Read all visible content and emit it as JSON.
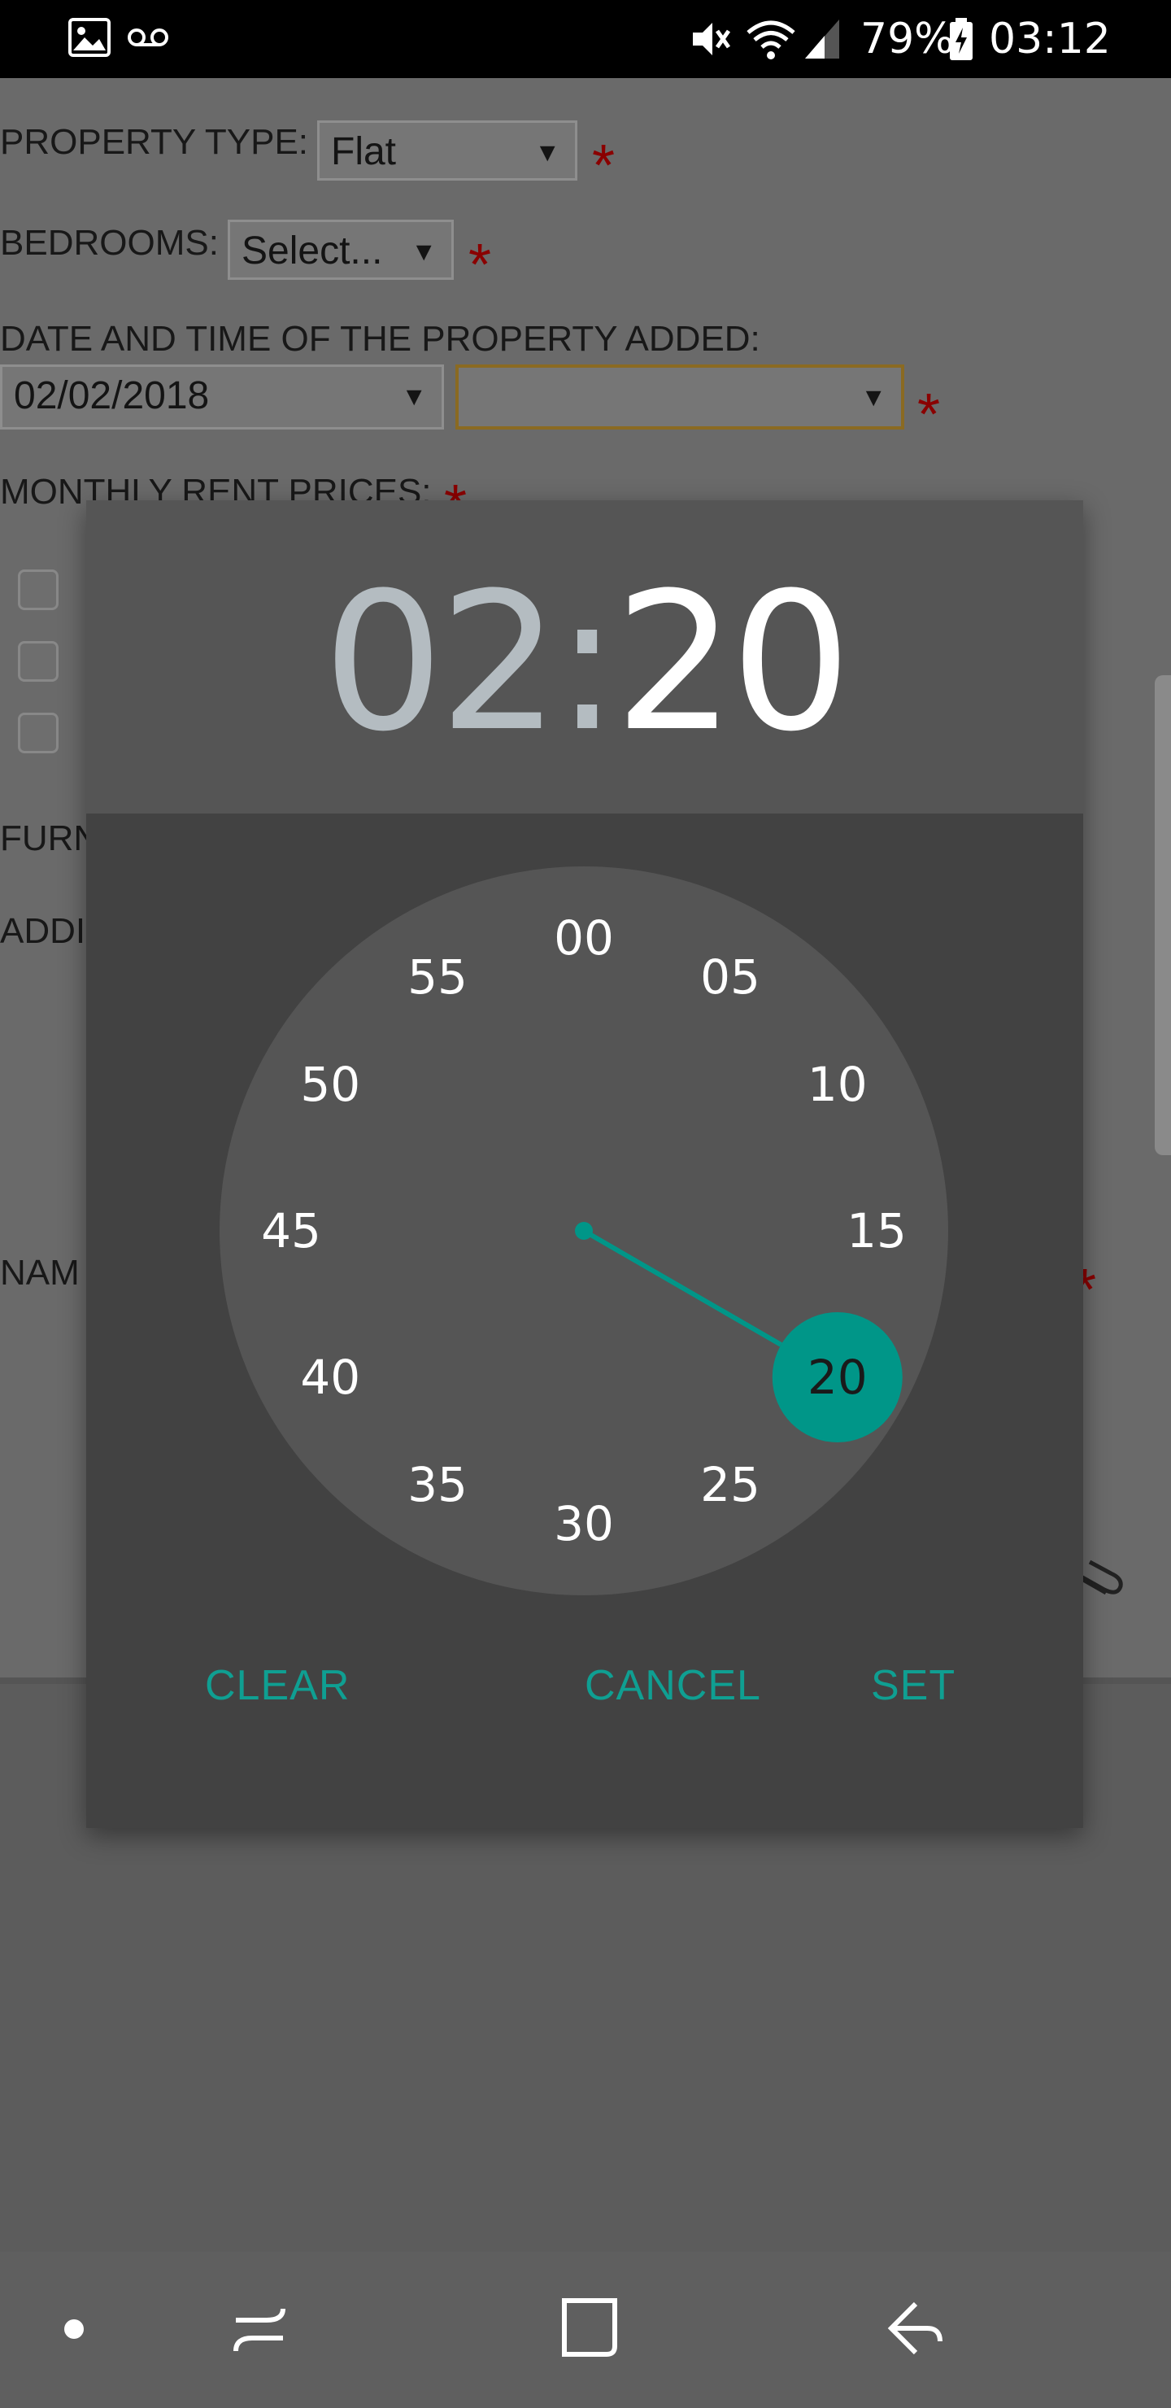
{
  "status_bar": {
    "battery": "79%",
    "time": "03:12",
    "icons": [
      "image-icon",
      "voicemail-icon",
      "mute-icon",
      "wifi-icon",
      "signal-icon",
      "battery-icon"
    ]
  },
  "form": {
    "property_type": {
      "label": "PROPERTY TYPE:",
      "value": "Flat"
    },
    "bedrooms": {
      "label": "BEDROOMS:",
      "value": "Select..."
    },
    "date_time": {
      "label": "DATE AND TIME OF THE PROPERTY ADDED:",
      "date_value": "02/02/2018",
      "time_value": ""
    },
    "monthly_rent": {
      "label": "MONTHLY RENT PRICES:"
    },
    "furnished_label": "FURN",
    "address_label": "ADDI",
    "name_label": "NAM",
    "required_mark": "*"
  },
  "time_picker": {
    "hour": "02",
    "separator": ":",
    "minute": "20",
    "selected_minute": "20",
    "minute_ticks": [
      "00",
      "05",
      "10",
      "15",
      "20",
      "25",
      "30",
      "35",
      "40",
      "45",
      "50",
      "55"
    ],
    "buttons": {
      "clear": "CLEAR",
      "cancel": "CANCEL",
      "set": "SET"
    },
    "accent_color": "#009688"
  }
}
